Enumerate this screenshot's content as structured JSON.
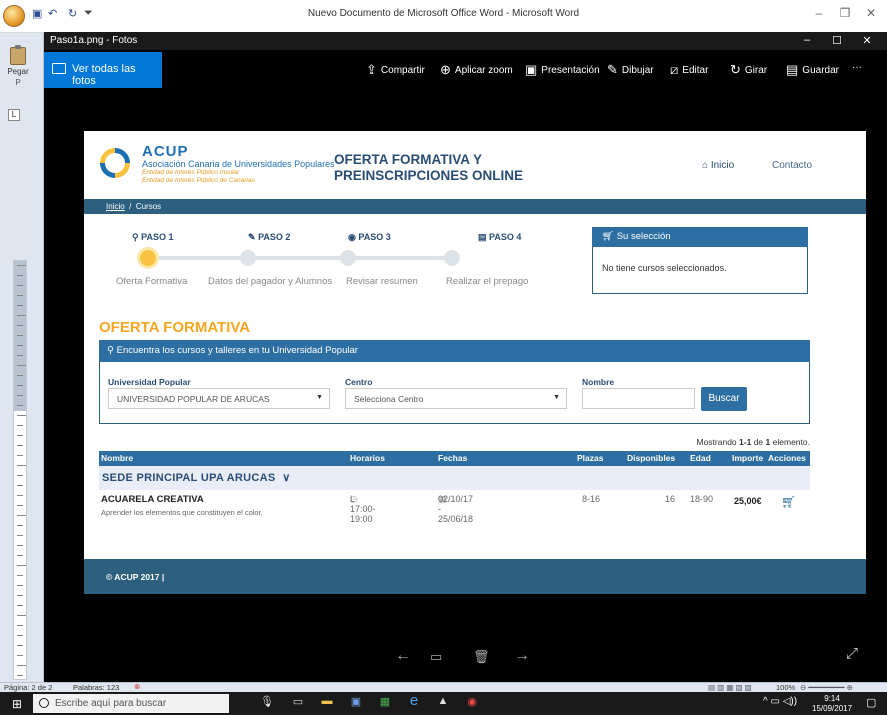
{
  "word": {
    "title": "Nuevo Documento de Microsoft Office Word - Microsoft Word",
    "paste_label": "Pegar",
    "ribbon_letter": "P",
    "ruler_box": "L",
    "status": {
      "page": "Página: 2 de 2",
      "words": "Palabras: 123",
      "zoom": "100%"
    }
  },
  "photos": {
    "title": "Paso1a.png - Fotos",
    "see_all": "Ver todas las fotos",
    "toolbar": [
      "Compartir",
      "Aplicar zoom",
      "Presentación",
      "Dibujar",
      "Editar",
      "Girar",
      "Guardar"
    ],
    "more": "···"
  },
  "web": {
    "brand": {
      "name": "ACUP",
      "full": "Asociación Canaria de Universidades Populares",
      "line1": "Entidad de Interés Público Insular",
      "line2": "Entidad de Interés Público de Canarias"
    },
    "heading": {
      "line1": "OFERTA FORMATIVA Y",
      "line2": "PREINSCRIPCIONES ONLINE"
    },
    "nav": {
      "inicio": "Inicio",
      "contacto": "Contacto"
    },
    "breadcrumb": {
      "home": "Inicio",
      "sep": "/",
      "current": "Cursos"
    },
    "steps": [
      {
        "num": "PASO 1",
        "label": "Oferta Formativa",
        "icon": "search-icon"
      },
      {
        "num": "PASO 2",
        "label": "Datos del pagador y Alumnos",
        "icon": "pencil-icon"
      },
      {
        "num": "PASO 3",
        "label": "Revisar resumen",
        "icon": "eye-icon"
      },
      {
        "num": "PASO 4",
        "label": "Realizar el prepago",
        "icon": "card-icon"
      }
    ],
    "selection": {
      "title": "Su selección",
      "empty": "No tiene cursos seleccionados."
    },
    "section_title": "OFERTA FORMATIVA",
    "search_box": {
      "title": "Encuentra los cursos y talleres en tu Universidad Popular",
      "universidad_label": "Universidad Popular",
      "universidad_value": "UNIVERSIDAD POPULAR DE ARUCAS",
      "centro_label": "Centro",
      "centro_value": "Selecciona Centro",
      "nombre_label": "Nombre",
      "nombre_value": "",
      "button": "Buscar"
    },
    "results": {
      "prefix": "Mostrando",
      "range": "1-1",
      "of": "de",
      "total": "1",
      "suffix": "elemento."
    },
    "table": {
      "headers": [
        "Nombre",
        "Horarios",
        "Fechas",
        "Plazas",
        "Disponibles",
        "Edad",
        "Importe",
        "Acciones"
      ],
      "group": "SEDE PRINCIPAL UPA ARUCAS",
      "row": {
        "name": "ACUARELA CREATIVA",
        "desc": "Aprender los elementos que constituyen el color,",
        "horario": "L 17:00-19:00",
        "fechas": "02/10/17 - 25/06/18",
        "plazas": "8-16",
        "disponibles": "16",
        "edad": "18-90",
        "importe": "25,00€"
      }
    },
    "footer": "© ACUP 2017 |"
  },
  "taskbar": {
    "search": "Escribe aquí para buscar",
    "time": "9:14",
    "date": "15/09/2017"
  }
}
